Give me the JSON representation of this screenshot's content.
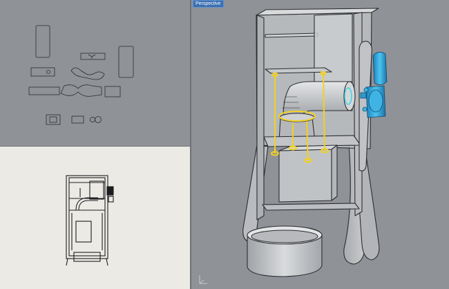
{
  "viewports": {
    "top": {
      "label": ""
    },
    "front": {
      "label": ""
    },
    "perspective": {
      "label": "Perspective"
    }
  },
  "colors": {
    "viewport_bg": "#8f9297",
    "paper_bg": "#eceae5",
    "outline": "#2a2c30",
    "highlight_yellow": "#f2d21e",
    "selection_blue": "#39b6e6",
    "label_bg": "#3a6fb0"
  },
  "icons": {
    "axis": "axis-triad-icon"
  }
}
